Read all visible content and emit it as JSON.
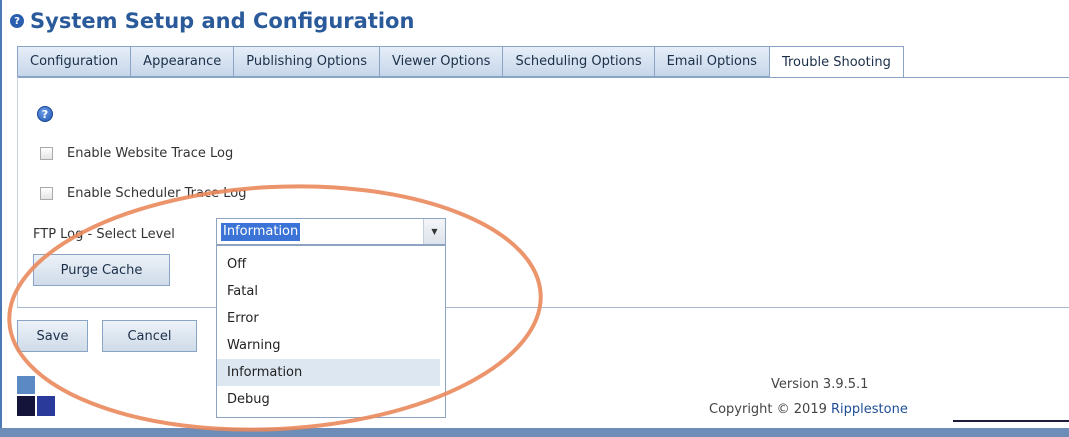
{
  "page": {
    "title": "System Setup and Configuration",
    "title_icon": "question-circle-icon"
  },
  "tabs": [
    {
      "label": "Configuration",
      "active": false
    },
    {
      "label": "Appearance",
      "active": false
    },
    {
      "label": "Publishing Options",
      "active": false
    },
    {
      "label": "Viewer Options",
      "active": false
    },
    {
      "label": "Scheduling Options",
      "active": false
    },
    {
      "label": "Email Options",
      "active": false
    },
    {
      "label": "Trouble Shooting",
      "active": true
    }
  ],
  "troubleshooting": {
    "help_icon": "help-circle-icon",
    "website_trace": {
      "label": "Enable Website Trace Log",
      "checked": false
    },
    "scheduler_trace": {
      "label": "Enable Scheduler Trace Log",
      "checked": false
    },
    "ftp_log": {
      "label": "FTP Log - Select Level",
      "selected": "Information",
      "options": [
        "Off",
        "Fatal",
        "Error",
        "Warning",
        "Information",
        "Debug"
      ]
    },
    "purge_cache_label": "Purge Cache"
  },
  "footer": {
    "save_label": "Save",
    "cancel_label": "Cancel",
    "version": "Version 3.9.5.1",
    "copyright_prefix": "Copyright © 2019",
    "brand": "Ripplestone"
  },
  "colors": {
    "accent": "#2b5a9a",
    "annotation": "#ea8a5c",
    "selection": "#3b74d6"
  }
}
